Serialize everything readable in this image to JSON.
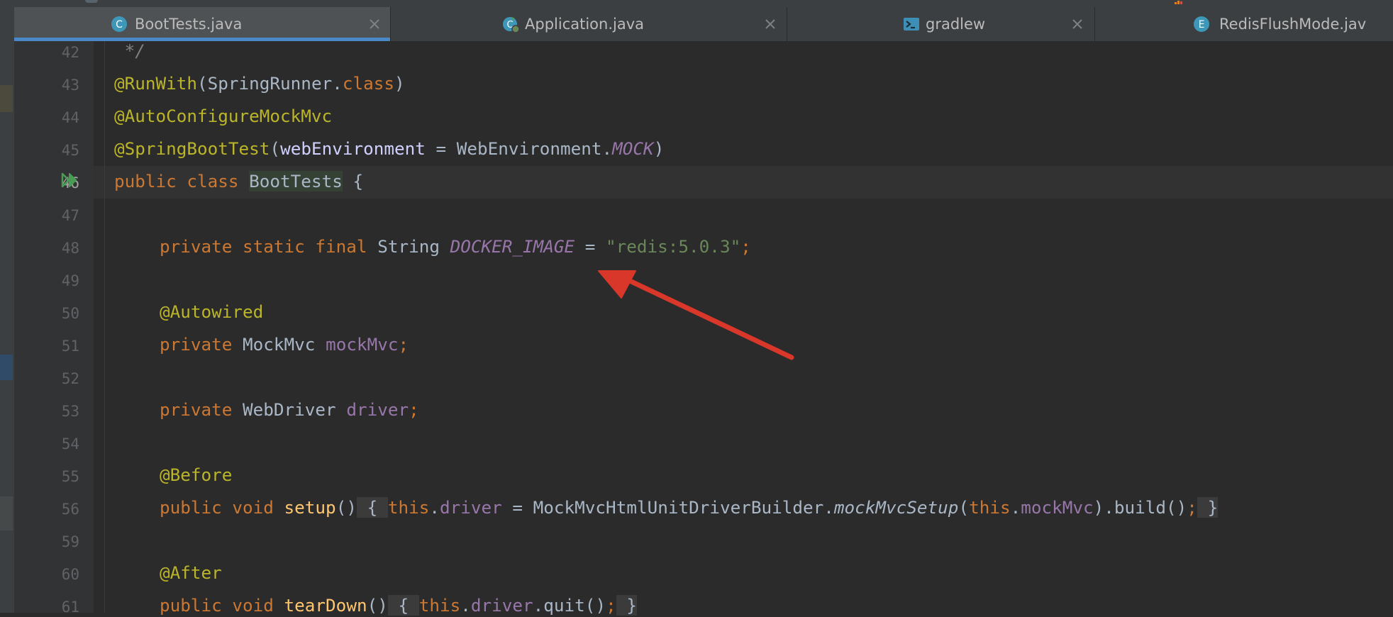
{
  "tabs": [
    {
      "label": "BootTests.java",
      "icon": "java-class-icon",
      "active": true
    },
    {
      "label": "Application.java",
      "icon": "spring-boot-app-icon",
      "active": false
    },
    {
      "label": "gradlew",
      "icon": "terminal-script-icon",
      "active": false
    },
    {
      "label": "RedisFlushMode.jav",
      "icon": "enum-icon",
      "active": false
    }
  ],
  "tab_icon_letters": {
    "class": "C",
    "enum": "E"
  },
  "line_numbers": [
    "42",
    "43",
    "44",
    "45",
    "46",
    "47",
    "48",
    "49",
    "50",
    "51",
    "52",
    "53",
    "54",
    "55",
    "56",
    "59",
    "60",
    "61"
  ],
  "active_line": "46",
  "code": {
    "l42": " */",
    "l43": {
      "ann": "@RunWith",
      "p1": "(SpringRunner.",
      "kw": "class",
      "p2": ")"
    },
    "l44": {
      "ann": "@AutoConfigureMockMvc"
    },
    "l45": {
      "ann": "@SpringBootTest",
      "p1": "(",
      "param": "webEnvironment",
      "p2": " = WebEnvironment.",
      "cst": "MOCK",
      "p3": ")"
    },
    "l46": {
      "kw": "public class ",
      "cls": "BootTests",
      "p1": " {"
    },
    "l48": {
      "kw": "private static final ",
      "type": "String ",
      "cst": "DOCKER_IMAGE",
      "p1": " = ",
      "str": "\"redis:5.0.3\"",
      "semi": ";"
    },
    "l50": {
      "ann": "@Autowired"
    },
    "l51": {
      "kw": "private ",
      "type": "MockMvc ",
      "fld": "mockMvc",
      "semi": ";"
    },
    "l53": {
      "kw": "private ",
      "type": "WebDriver ",
      "fld": "driver",
      "semi": ";"
    },
    "l55": {
      "ann": "@Before"
    },
    "l56": {
      "kw": "public void ",
      "fn": "setup",
      "p1": "()",
      "ob": " { ",
      "this1": "this",
      "dot1": ".",
      "fld1": "driver",
      "p2": " = MockMvcHtmlUnitDriverBuilder.",
      "ital": "mockMvcSetup",
      "p3": "(",
      "this2": "this",
      "dot2": ".",
      "fld2": "mockMvc",
      "p4": ").build()",
      "semi": ";",
      "cb": " }"
    },
    "l60": {
      "ann": "@After"
    },
    "l61": {
      "kw": "public void ",
      "fn": "tearDown",
      "p1": "()",
      "ob": " { ",
      "this1": "this",
      "dot1": ".",
      "fld1": "driver",
      "p2": ".quit()",
      "semi": ";",
      "cb": " }"
    }
  },
  "colors": {
    "background": "#2b2b2b",
    "keyword": "#cc7832",
    "annotation": "#bbb529",
    "string": "#6a8759",
    "field": "#9876aa",
    "function": "#ffc66d",
    "text": "#a9b7c6",
    "arrow": "#d9372a",
    "run_icon": "#499c54"
  },
  "annotation_arrow": {
    "shape": "red-arrow",
    "points_to": "DOCKER_IMAGE"
  }
}
